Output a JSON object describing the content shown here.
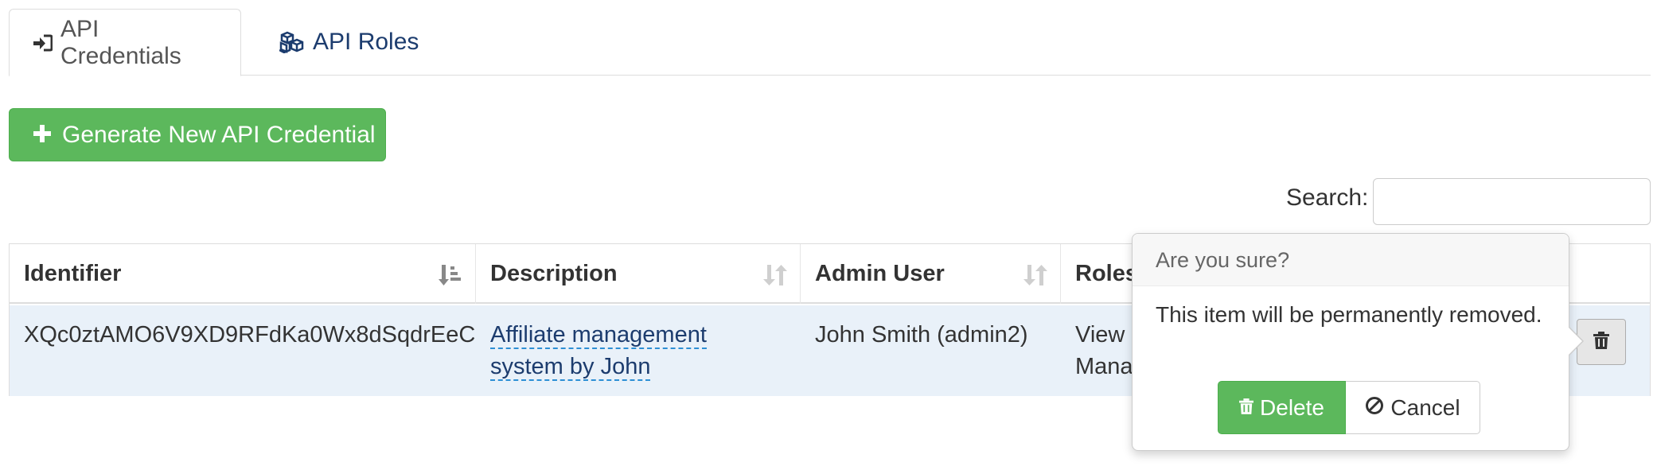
{
  "tabs": [
    {
      "label": "API Credentials",
      "icon": "sign-in-icon",
      "active": true
    },
    {
      "label": "API Roles",
      "icon": "cubes-icon",
      "active": false
    }
  ],
  "actions": {
    "generate_label": "Generate New API Credential"
  },
  "search": {
    "label": "Search:",
    "value": ""
  },
  "table": {
    "headers": [
      "Identifier",
      "Description",
      "Admin User",
      "Roles"
    ],
    "rows": [
      {
        "identifier": "XQc0ztAMO6V9XD9RFdKa0Wx8dSqdrEeC",
        "description_line1": "Affiliate management",
        "description_line2": "system by John",
        "admin_user": "John Smith (admin2)",
        "roles_line1": "View C",
        "roles_line2": "Manag"
      }
    ]
  },
  "popover": {
    "title": "Are you sure?",
    "message": "This item will be permanently removed.",
    "delete_label": "Delete",
    "cancel_label": "Cancel"
  },
  "colors": {
    "success": "#5cb85c",
    "link": "#1c3c6e",
    "row_highlight": "#e9f1f9",
    "dashed_underline": "#2d8fd5"
  }
}
